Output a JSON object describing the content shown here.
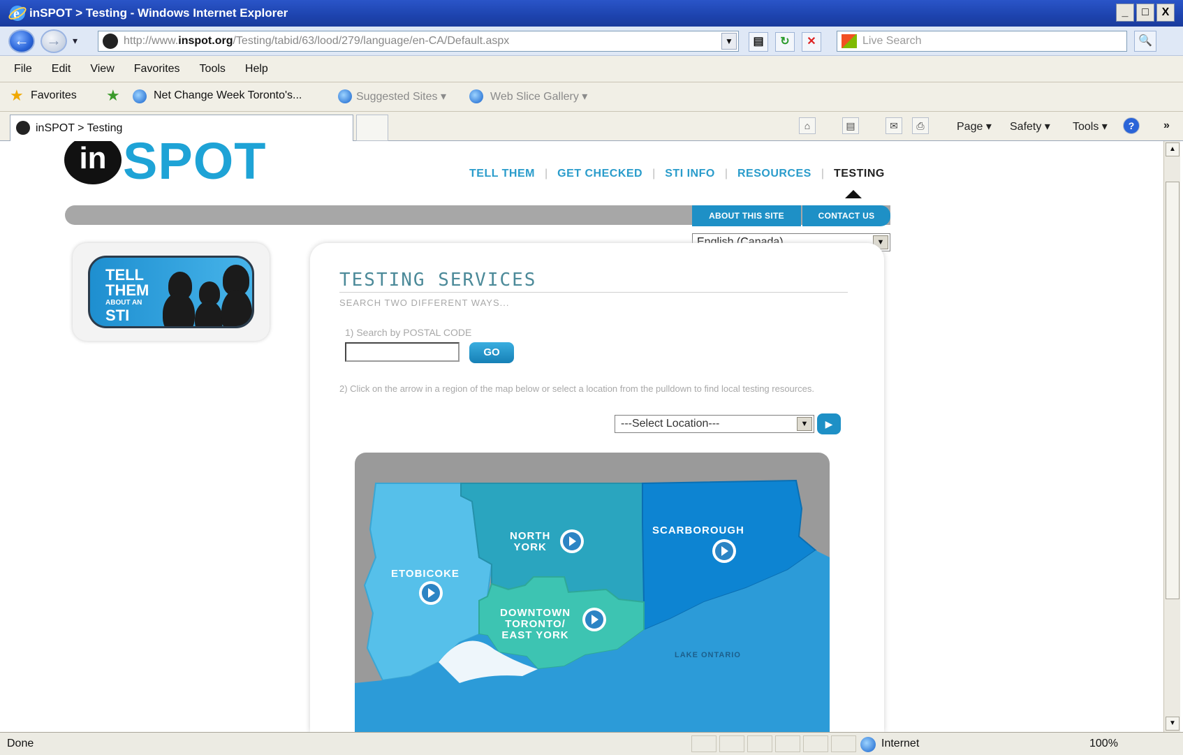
{
  "window": {
    "title": "inSPOT > Testing - Windows Internet Explorer",
    "controls": [
      "_",
      "□",
      "X"
    ]
  },
  "address_bar": {
    "url_prefix": "http://www.",
    "url_domain": "inspot.org",
    "url_path": "/Testing/tabid/63/lood/279/language/en-CA/Default.aspx",
    "search_placeholder": "Live Search"
  },
  "menu": {
    "items": [
      "File",
      "Edit",
      "View",
      "Favorites",
      "Tools",
      "Help"
    ]
  },
  "favorites_bar": {
    "favorites_label": "Favorites",
    "link1": "Net Change Week Toronto's...",
    "link2": "Suggested Sites ▾",
    "link3": "Web Slice Gallery ▾"
  },
  "tabs": {
    "active_tab": "inSPOT > Testing"
  },
  "command_bar": {
    "page": "Page ▾",
    "safety": "Safety ▾",
    "tools": "Tools ▾",
    "help": "?"
  },
  "site": {
    "logo_in": "in",
    "logo_spot": "SPOT",
    "nav": [
      "TELL THEM",
      "GET CHECKED",
      "STI INFO",
      "RESOURCES",
      "TESTING"
    ],
    "active_nav": "TESTING",
    "about_btn": "ABOUT THIS SITE",
    "contact_btn": "CONTACT US",
    "language": "English (Canada)",
    "tell_card": {
      "line1": "TELL",
      "line2": "THEM",
      "line3": "ABOUT AN",
      "line4": "STI"
    },
    "testing": {
      "title": "TESTING SERVICES",
      "subtitle": "SEARCH TWO DIFFERENT WAYS...",
      "postal_label": "1) Search by POSTAL CODE",
      "go_label": "GO",
      "map_instructions": "2) Click on the arrow in a region of the map below or select a location from the pulldown to find local testing resources.",
      "location_select": "---Select Location---"
    },
    "map": {
      "regions": [
        {
          "label": "ETOBICOKE"
        },
        {
          "label": "NORTH\nYORK"
        },
        {
          "label": "SCARBOROUGH"
        },
        {
          "label": "DOWNTOWN\nTORONTO/\nEAST YORK"
        }
      ],
      "lake_label": "LAKE ONTARIO"
    }
  },
  "status_bar": {
    "status": "Done",
    "zone": "Internet",
    "zoom": "100%"
  },
  "colors": {
    "brand_blue": "#1ea3d6",
    "button_blue": "#1e90c6",
    "title_teal": "#4c8a99"
  }
}
